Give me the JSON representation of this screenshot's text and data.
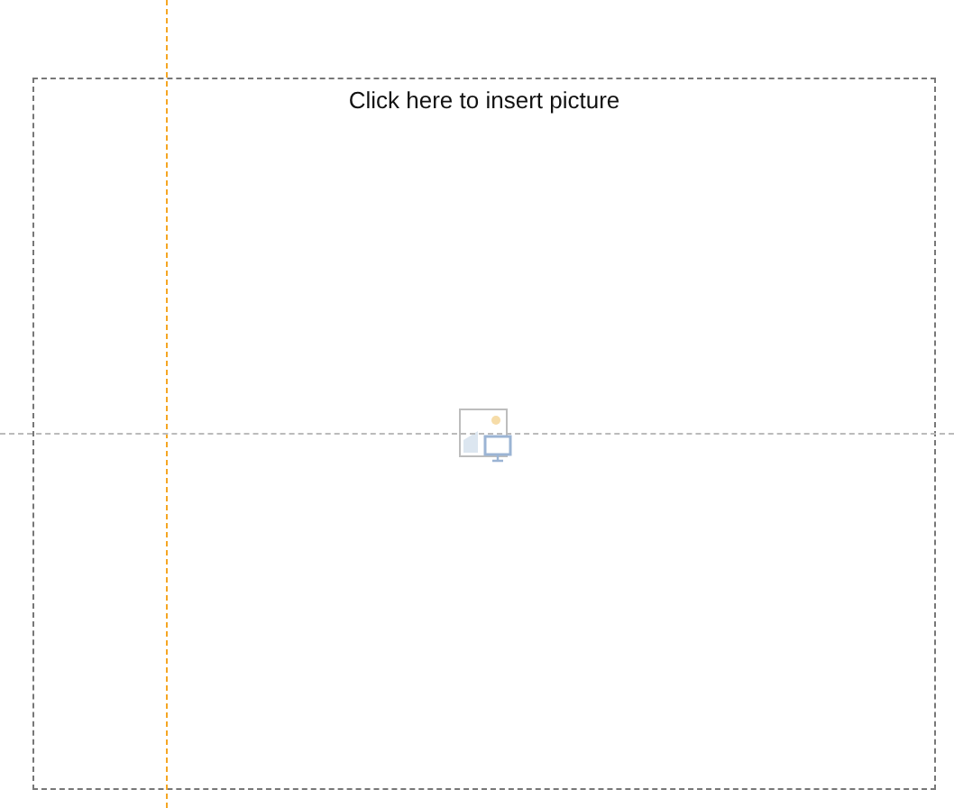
{
  "placeholder": {
    "prompt": "Click here to insert picture"
  }
}
